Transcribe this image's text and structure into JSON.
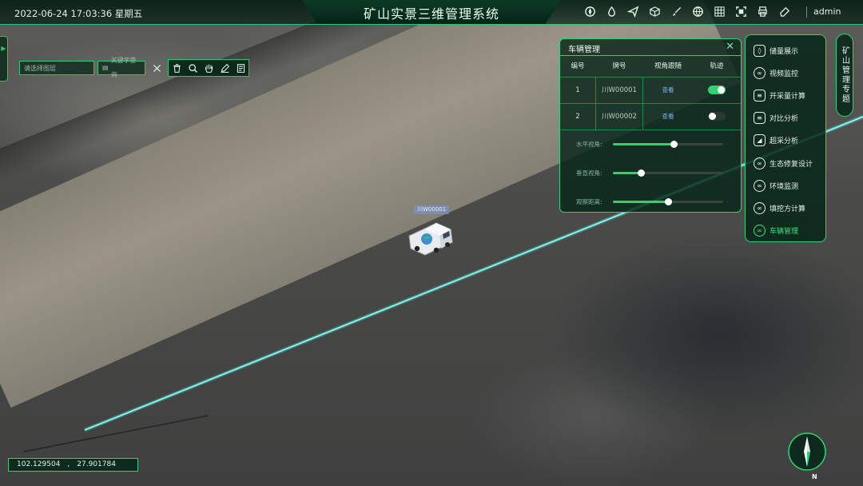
{
  "header": {
    "datetime": "2022-06-24 17:03:36 星期五",
    "title": "矿山实景三维管理系统",
    "user": "admin",
    "tools": [
      "compass-tool-icon",
      "drop-icon",
      "send-icon",
      "cube-icon",
      "brush-icon",
      "globe-icon",
      "grid-icon",
      "frame-icon",
      "print-icon",
      "eraser-icon"
    ]
  },
  "search": {
    "place_placeholder": "请选择图层",
    "keyword_placeholder": "关键字查询"
  },
  "vehicle_panel": {
    "title": "车辆管理",
    "headers": [
      "编号",
      "牌号",
      "视角跟随",
      "轨迹"
    ],
    "rows": [
      {
        "id": "1",
        "plate": "川W00001",
        "view": "查看",
        "track": true
      },
      {
        "id": "2",
        "plate": "川W00002",
        "view": "查看",
        "track": false
      }
    ],
    "sliders": [
      {
        "label": "水平视角:",
        "value": 0.55
      },
      {
        "label": "垂直视角:",
        "value": 0.25
      },
      {
        "label": "观察距离:",
        "value": 0.5
      }
    ]
  },
  "menu": {
    "items": [
      {
        "label": "储量展示",
        "icon": "car-icon"
      },
      {
        "label": "视频监控",
        "icon": "ring-icon"
      },
      {
        "label": "开采量计算",
        "icon": "doc-icon"
      },
      {
        "label": "对比分析",
        "icon": "doc-icon"
      },
      {
        "label": "超采分析",
        "icon": "square-icon"
      },
      {
        "label": "生态修复设计",
        "icon": "ring-icon"
      },
      {
        "label": "环境监测",
        "icon": "ring-icon"
      },
      {
        "label": "填挖方计算",
        "icon": "ring-icon"
      },
      {
        "label": "车辆管理",
        "icon": "ring-icon",
        "active": true
      }
    ],
    "side_tab": "矿山管理专题"
  },
  "map": {
    "vehicle_label": "川W00001",
    "coordinates": "102.129504　,　27.901784",
    "compass_label": "N"
  },
  "colors": {
    "accent": "#2fd171",
    "panel_bg": "#06261a",
    "track_line": "#5ff2ea"
  }
}
